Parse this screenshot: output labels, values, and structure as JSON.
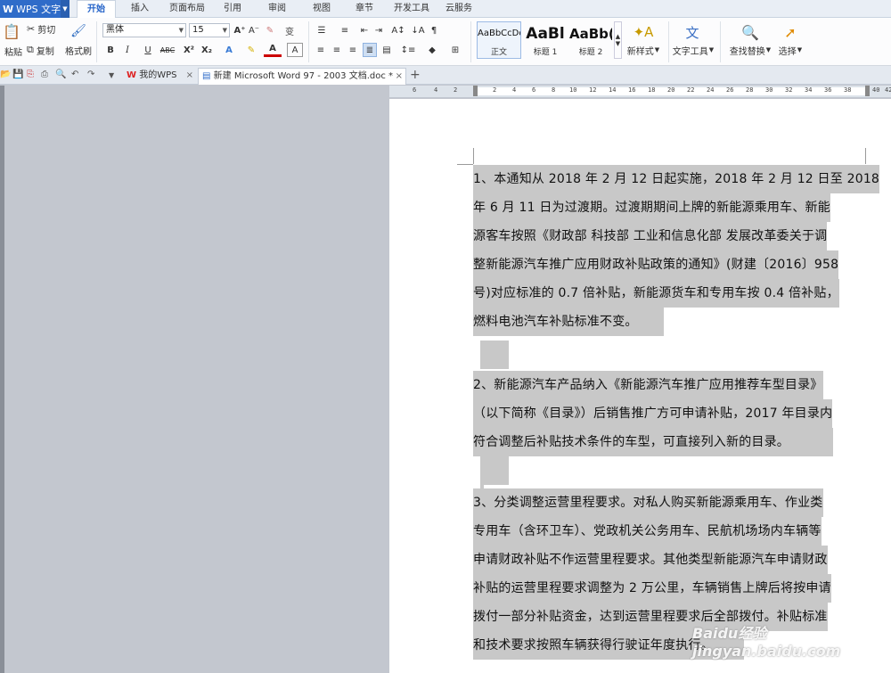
{
  "menubar": {
    "app_label": "WPS 文字",
    "tabs": [
      "开始",
      "插入",
      "页面布局",
      "引用",
      "审阅",
      "视图",
      "章节",
      "开发工具",
      "云服务"
    ],
    "active_tab": "开始"
  },
  "ribbon": {
    "paste_label": "粘贴",
    "cut_label": "剪切",
    "copy_label": "复制",
    "format_painter_label": "格式刷",
    "font_name": "黑体",
    "font_size": "15",
    "styles": [
      {
        "preview": "AaBbCcDd",
        "name": "正文"
      },
      {
        "preview": "AaBl",
        "name": "标题 1"
      },
      {
        "preview": "AaBb(",
        "name": "标题 2"
      }
    ],
    "new_style_label": "新样式",
    "text_tools_label": "文字工具",
    "find_replace_label": "查找替换",
    "select_label": "选择"
  },
  "tabbar": {
    "tabs": [
      {
        "title": "我的WPS"
      },
      {
        "title": "新建 Microsoft Word 97 - 2003 文档.doc *"
      }
    ],
    "new_tab_icon": "+"
  },
  "ruler": {
    "labels": [
      "6",
      "4",
      "2",
      "2",
      "4",
      "6",
      "8",
      "10",
      "12",
      "14",
      "16",
      "18",
      "20",
      "22",
      "24",
      "26",
      "28",
      "30",
      "32",
      "34",
      "36",
      "38",
      "40",
      "42"
    ]
  },
  "document": {
    "lines": [
      "1、本通知从 2018 年 2 月 12 日起实施，2018 年 2 月 12 日至 2018",
      "年 6 月 11 日为过渡期。过渡期期间上牌的新能源乘用车、新能",
      "源客车按照《财政部 科技部 工业和信息化部 发展改革委关于调",
      "整新能源汽车推广应用财政补贴政策的通知》(财建〔2016〕958",
      "号)对应标准的 0.7 倍补贴，新能源货车和专用车按 0.4 倍补贴，",
      "燃料电池汽车补贴标准不变。",
      "",
      "2、新能源汽车产品纳入《新能源汽车推广应用推荐车型目录》",
      "（以下简称《目录》）后销售推广方可申请补贴，2017 年目录内",
      "符合调整后补贴技术条件的车型，可直接列入新的目录。",
      "",
      "",
      "3、分类调整运营里程要求。对私人购买新能源乘用车、作业类",
      "专用车（含环卫车）、党政机关公务用车、民航机场场内车辆等",
      "申请财政补贴不作运营里程要求。其他类型新能源汽车申请财政",
      "补贴的运营里程要求调整为 2 万公里，车辆销售上牌后将按申请",
      "拨付一部分补贴资金，达到运营里程要求后全部拨付。补贴标准",
      "和技术要求按照车辆获得行驶证年度执行。"
    ],
    "watermark": "Baidu经验 jingyan.baidu.com"
  }
}
